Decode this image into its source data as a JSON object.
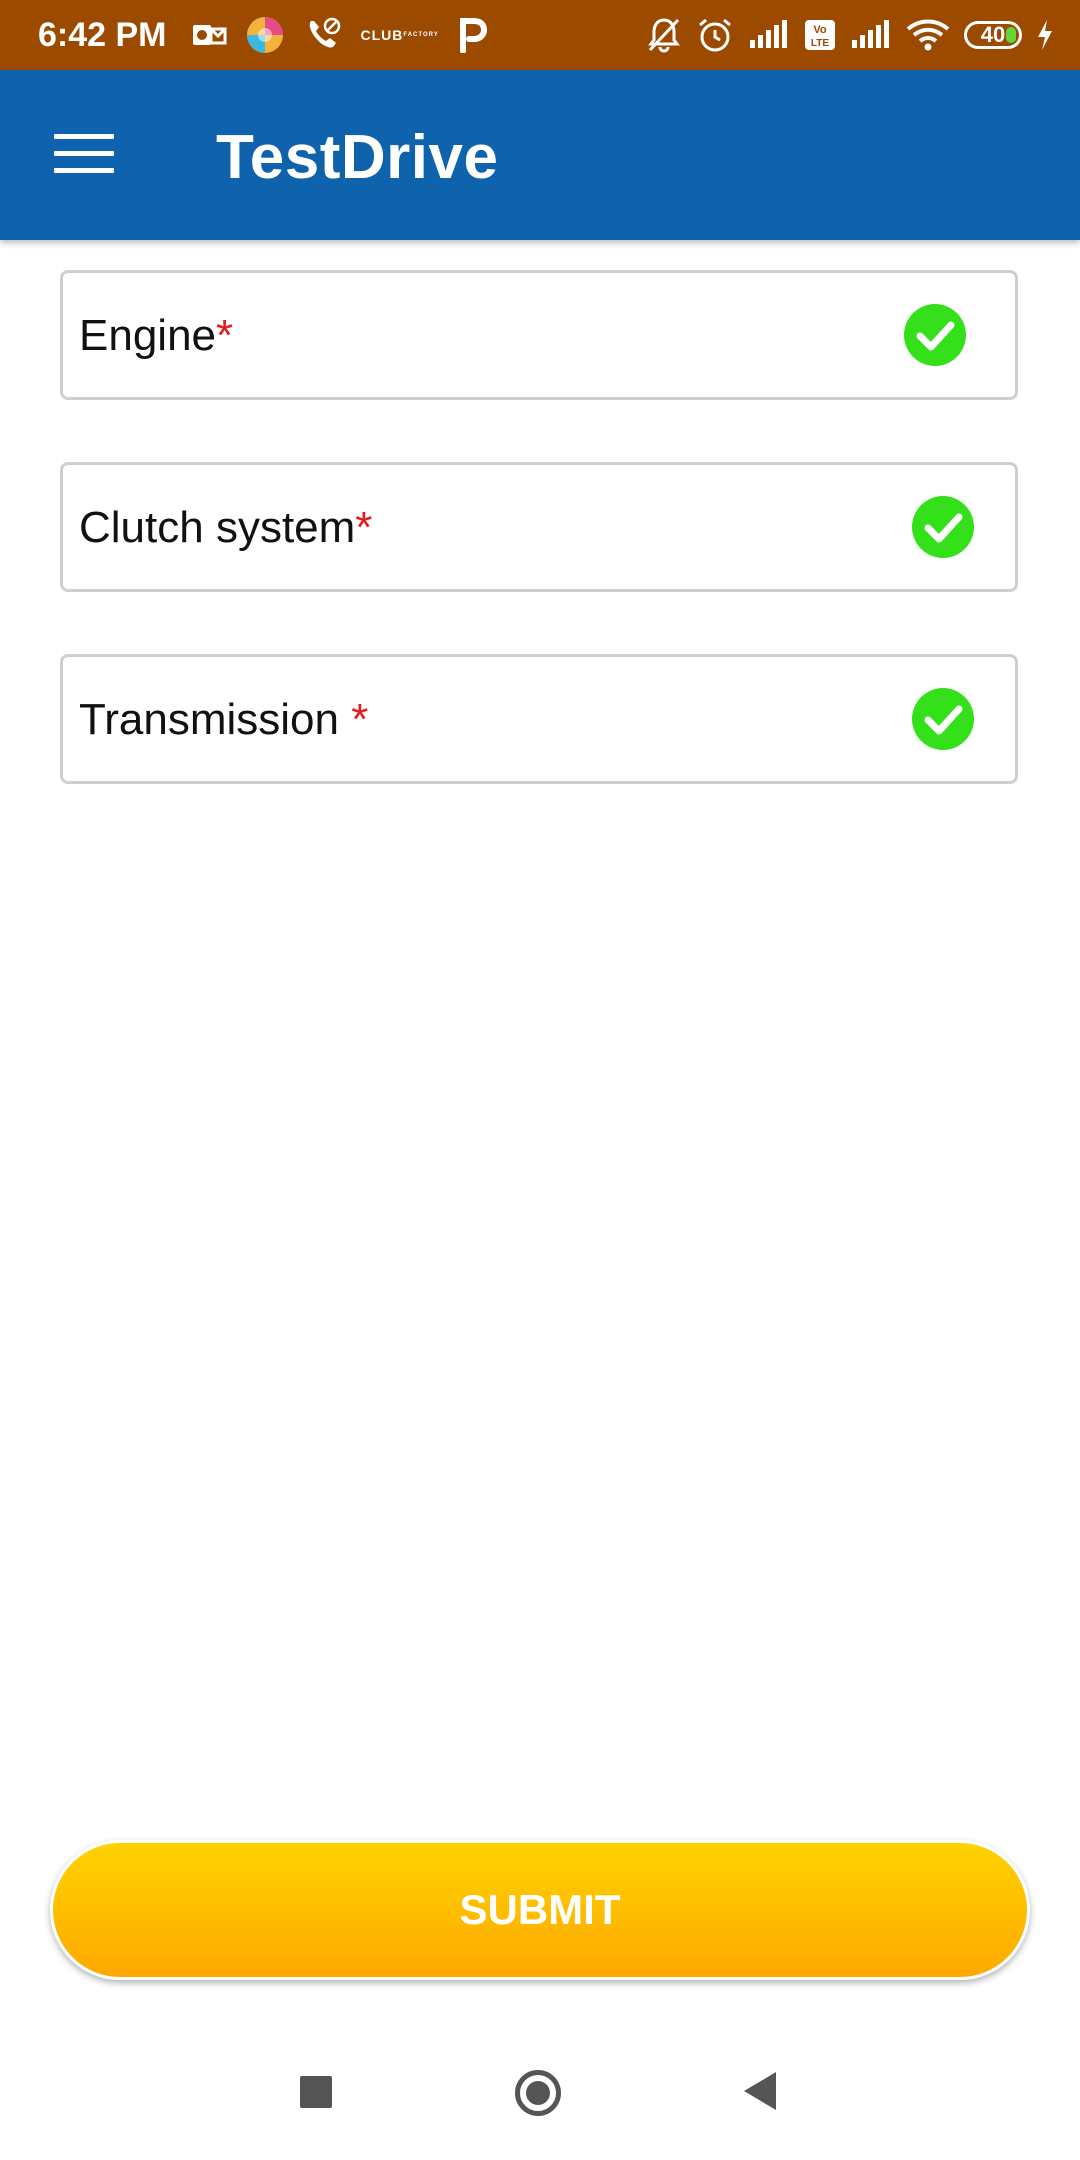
{
  "status_bar": {
    "time": "6:42 PM",
    "club_logo_text": "CLUB",
    "club_logo_sub": "FACTORY",
    "battery_level": "40",
    "volte_label": "Vo LTE"
  },
  "app_bar": {
    "title": "TestDrive"
  },
  "checklist": [
    {
      "label": "Engine",
      "required_mark": "*",
      "checked": true
    },
    {
      "label": "Clutch system",
      "required_mark": "*",
      "checked": true
    },
    {
      "label": "Transmission ",
      "required_mark": "*",
      "checked": true
    }
  ],
  "submit": {
    "label": "SUBMIT"
  },
  "colors": {
    "status_bar": "#9c4a00",
    "app_bar": "#0f63ad",
    "check": "#33e01a",
    "required": "#e01e1e",
    "submit_top": "#ffd300",
    "submit_bottom": "#ffa800"
  }
}
